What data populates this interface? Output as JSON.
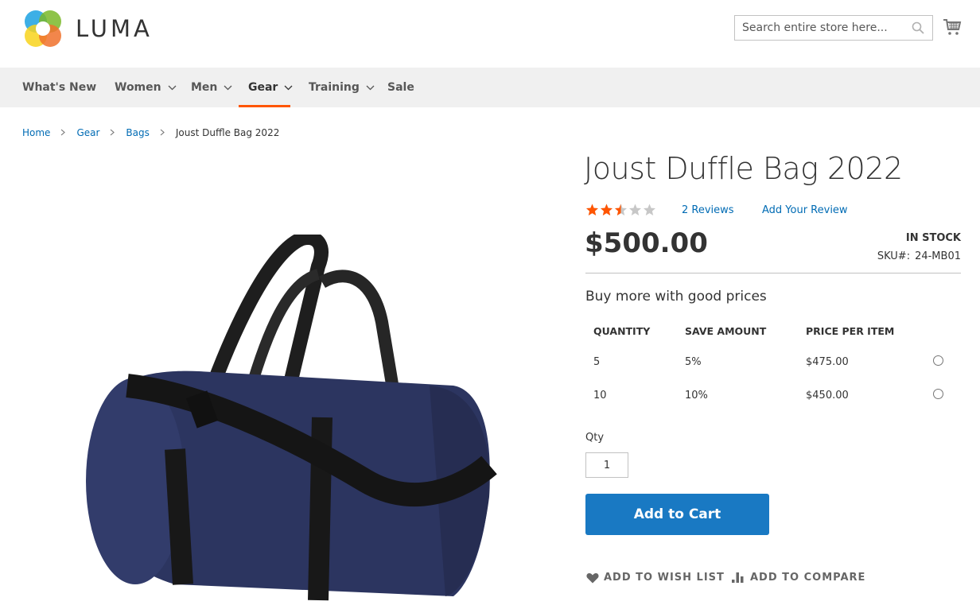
{
  "header": {
    "logo_text": "LUMA",
    "search_placeholder": "Search entire store here...",
    "icons": {
      "search": "search-icon",
      "cart": "cart-icon"
    }
  },
  "nav": {
    "items": [
      {
        "label": "What's New",
        "has_dropdown": false,
        "active": false
      },
      {
        "label": "Women",
        "has_dropdown": true,
        "active": false
      },
      {
        "label": "Men",
        "has_dropdown": true,
        "active": false
      },
      {
        "label": "Gear",
        "has_dropdown": true,
        "active": true
      },
      {
        "label": "Training",
        "has_dropdown": true,
        "active": false
      },
      {
        "label": "Sale",
        "has_dropdown": false,
        "active": false
      }
    ],
    "accent_color": "#ff5501"
  },
  "breadcrumbs": [
    {
      "label": "Home",
      "link": true
    },
    {
      "label": "Gear",
      "link": true
    },
    {
      "label": "Bags",
      "link": true
    },
    {
      "label": "Joust Duffle Bag 2022",
      "link": false
    }
  ],
  "product": {
    "title": "Joust Duffle Bag 2022",
    "image_alt": "Navy duffle bag with black straps",
    "rating": {
      "value": 2.5,
      "max": 5,
      "star_color": "#ff5501",
      "empty_color": "#c7c7c7"
    },
    "reviews_link": "2  Reviews",
    "add_review_link": "Add Your Review",
    "price": "$500.00",
    "stock": "In stock",
    "sku_label": "SKU#:",
    "sku": "24-MB01",
    "tier_pricing": {
      "title": "Buy more with good prices",
      "headers": [
        "Quantity",
        "Save Amount",
        "Price Per Item"
      ],
      "rows": [
        {
          "quantity": "5",
          "save": "5%",
          "price": "$475.00",
          "selected": false
        },
        {
          "quantity": "10",
          "save": "10%",
          "price": "$450.00",
          "selected": false
        }
      ]
    },
    "qty_label": "Qty",
    "qty_value": "1",
    "add_to_cart": "Add to Cart",
    "add_to_cart_color": "#1979c3",
    "wishlist_label": "Add to Wish List",
    "compare_label": "Add to Compare"
  }
}
